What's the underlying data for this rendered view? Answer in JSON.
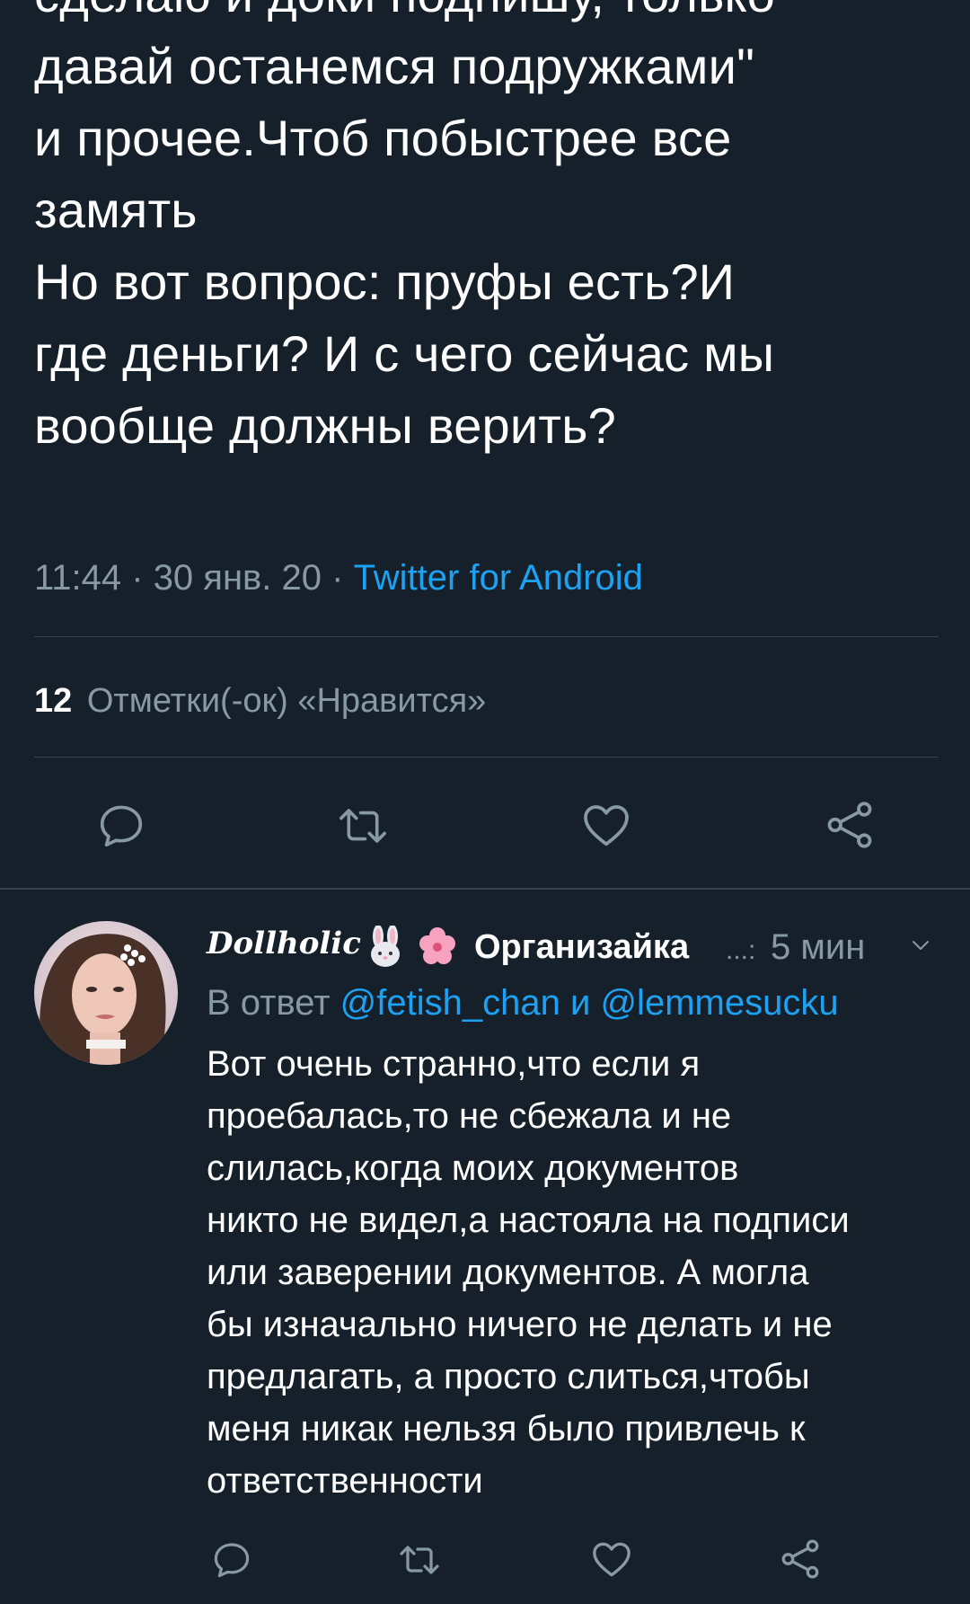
{
  "main_tweet": {
    "text": "сделаю и доки подпишу, только\nдавай останемся подружками\"\nи прочее.Чтоб побыстрее все\nзамять\nНо вот вопрос: пруфы есть?И\nгде деньги? И с чего сейчас мы\nвообще должны верить?",
    "time": "11:44",
    "date": "30 янв. 20",
    "separator": " · ",
    "source": "Twitter for Android",
    "likes_count": "12",
    "likes_label": "Отметки(-ок) «Нравится»"
  },
  "actions": {
    "reply_icon": "reply-icon",
    "retweet_icon": "retweet-icon",
    "like_icon": "heart-icon",
    "share_icon": "share-icon"
  },
  "reply_tweet": {
    "display_name": "Dollholic",
    "org_name": "Организайка",
    "ellipsis": "...:",
    "time": "5 мин",
    "reply_to_prefix": "В ответ",
    "mention_1": "@fetish_chan",
    "conjunction": "и",
    "mention_2": "@lemmesucku",
    "text": "Вот очень странно,что если я\nпроебалась,то не сбежала и не\nслилась,когда моих документов\nникто не видел,а настояла на подписи\nили заверении документов. А могла\nбы изначально ничего не делать и не\nпредлагать, а просто слиться,чтобы\nменя никак нельзя было привлечь к\nответственности"
  },
  "colors": {
    "background": "#15202b",
    "text": "#ffffff",
    "secondary": "#8899a6",
    "accent": "#1da1f2",
    "divider": "#38444d"
  }
}
